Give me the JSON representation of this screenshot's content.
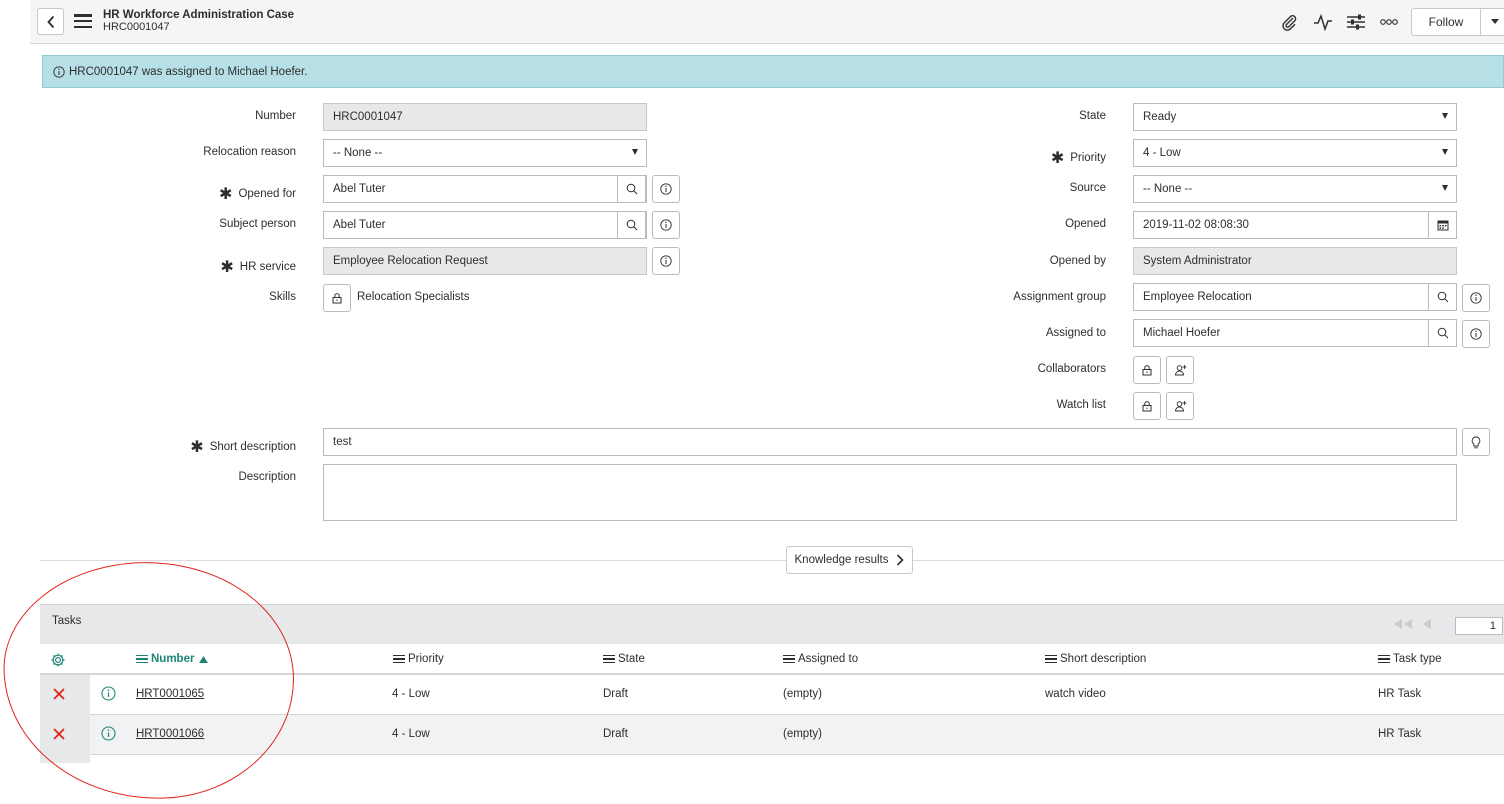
{
  "header": {
    "title": "HR Workforce Administration Case",
    "number": "HRC0001047",
    "follow_label": "Follow"
  },
  "banner": {
    "message": "HRC0001047 was assigned to Michael Hoefer."
  },
  "form": {
    "left": {
      "number": {
        "label": "Number",
        "value": "HRC0001047"
      },
      "relocation_reason": {
        "label": "Relocation reason",
        "value": "-- None --"
      },
      "opened_for": {
        "label": "Opened for",
        "value": "Abel Tuter"
      },
      "subject_person": {
        "label": "Subject person",
        "value": "Abel Tuter"
      },
      "hr_service": {
        "label": "HR service",
        "value": "Employee Relocation Request"
      },
      "skills": {
        "label": "Skills",
        "value": "Relocation Specialists"
      }
    },
    "right": {
      "state": {
        "label": "State",
        "value": "Ready"
      },
      "priority": {
        "label": "Priority",
        "value": "4 - Low"
      },
      "source": {
        "label": "Source",
        "value": "-- None --"
      },
      "opened": {
        "label": "Opened",
        "value": "2019-11-02 08:08:30"
      },
      "opened_by": {
        "label": "Opened by",
        "value": "System Administrator"
      },
      "assignment_group": {
        "label": "Assignment group",
        "value": "Employee Relocation"
      },
      "assigned_to": {
        "label": "Assigned to",
        "value": "Michael Hoefer"
      },
      "collaborators": {
        "label": "Collaborators"
      },
      "watch_list": {
        "label": "Watch list"
      }
    },
    "short_description": {
      "label": "Short description",
      "value": "test"
    },
    "description": {
      "label": "Description",
      "value": ""
    }
  },
  "knowledge": {
    "label": "Knowledge results"
  },
  "tasks": {
    "title": "Tasks",
    "page": "1",
    "columns": {
      "number": "Number",
      "priority": "Priority",
      "state": "State",
      "assigned_to": "Assigned to",
      "short_description": "Short description",
      "task_type": "Task type"
    },
    "rows": [
      {
        "number": "HRT0001065",
        "priority": "4 - Low",
        "state": "Draft",
        "assigned_to": "(empty)",
        "short_description": "watch video",
        "task_type": "HR Task"
      },
      {
        "number": "HRT0001066",
        "priority": "4 - Low",
        "state": "Draft",
        "assigned_to": "(empty)",
        "short_description": "",
        "task_type": "HR Task"
      }
    ]
  },
  "colors": {
    "accent_green": "#1f8476",
    "banner_bg": "#b7dfe6",
    "delete_red": "#e0241b",
    "annotation_red": "#e0241b"
  }
}
